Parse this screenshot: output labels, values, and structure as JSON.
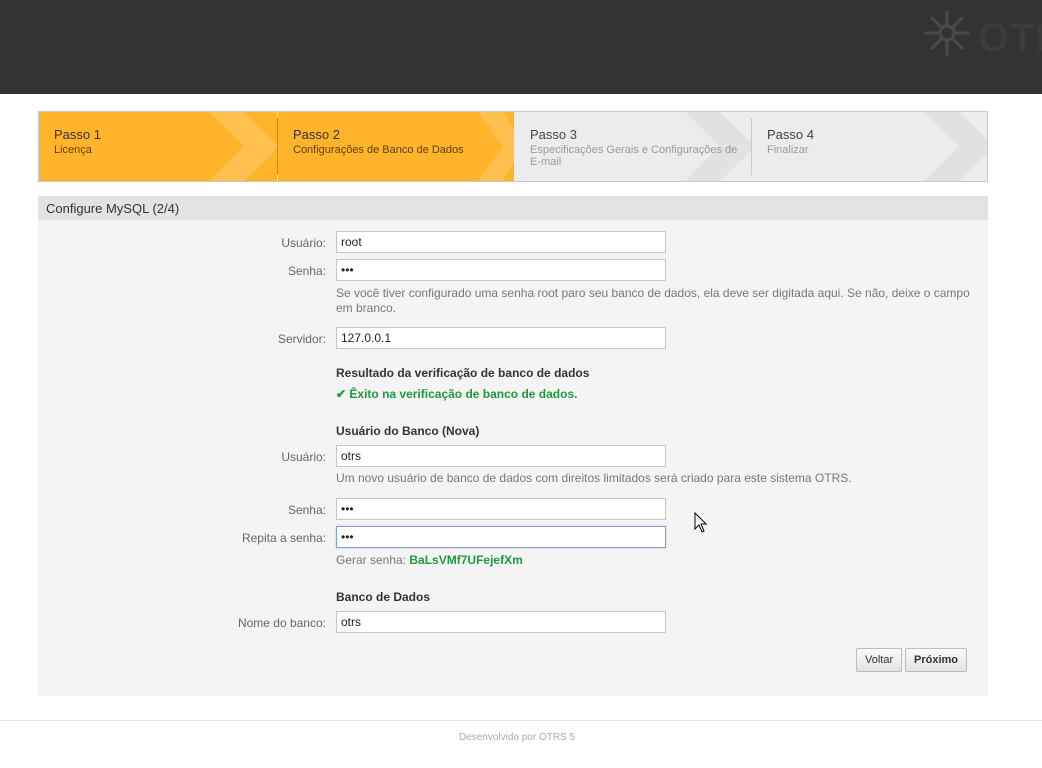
{
  "header": {
    "logo_text": "OTRS",
    "logo_icon": "otrs-asterisk-icon"
  },
  "steps": [
    {
      "title": "Passo 1",
      "desc": "Licença",
      "state": "done"
    },
    {
      "title": "Passo 2",
      "desc": "Configurações de Banco de Dados",
      "state": "current"
    },
    {
      "title": "Passo 3",
      "desc": "Especificações Gerais e Configurações de E-mail",
      "state": "pending"
    },
    {
      "title": "Passo 4",
      "desc": "Finalizar",
      "state": "pending"
    }
  ],
  "panel": {
    "title": "Configure MySQL (2/4)"
  },
  "admin": {
    "user_label": "Usuário:",
    "user_value": "root",
    "password_label": "Senha:",
    "password_value": "•••",
    "password_hint": "Se você tiver configurado uma senha root paro seu banco de dados, ela deve ser digitada aqui. Se não, deixe o campo em branco.",
    "server_label": "Servidor:",
    "server_value": "127.0.0.1"
  },
  "check": {
    "title": "Resultado da verificação de banco de dados",
    "result": "Êxito na verificação de banco de dados."
  },
  "new_user": {
    "section_title": "Usuário do Banco (Nova)",
    "user_label": "Usuário:",
    "user_value": "otrs",
    "user_hint": "Um novo usuário de banco de dados com direitos limitados será criado para este sistema OTRS.",
    "password_label": "Senha:",
    "password_value": "•••",
    "repeat_label": "Repita a senha:",
    "repeat_value": "•••",
    "generate_label": "Gerar senha:",
    "generated_password": "BaLsVMf7UFejefXm"
  },
  "database": {
    "section_title": "Banco de Dados",
    "name_label": "Nome do banco:",
    "name_value": "otrs"
  },
  "buttons": {
    "back": "Voltar",
    "next": "Próximo"
  },
  "footer": {
    "text": "Desenvolvido por OTRS 5"
  },
  "colors": {
    "header_bg": "#333333",
    "step_active": "#ffb42c",
    "success": "#1c9a3e"
  }
}
